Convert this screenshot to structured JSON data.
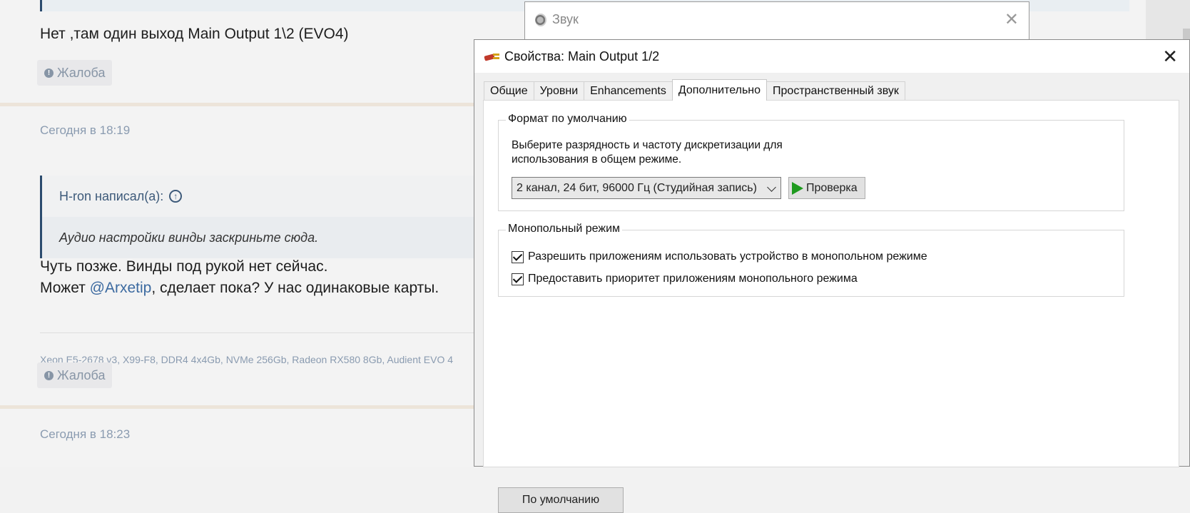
{
  "forum": {
    "post1_text": "Нет ,там один выход Main Output 1\\2 (EVO4)",
    "complain_label": "Жалоба",
    "post2_date": "Сегодня в 18:19",
    "quote_author": "H-ron написал(а):",
    "quote_text": "Аудио настройки винды заскриньте сюда.",
    "post2_line1": "Чуть позже. Винды под рукой нет сейчас.",
    "post2_line2_pre": "Может ",
    "post2_mention": "@Arxetip",
    "post2_line2_post": ", сделает пока? У нас одинаковые карты.",
    "signature": "Xeon E5-2678 v3, X99-F8, DDR4 4x4Gb, NVMe 256Gb, Radeon RX580 8Gb, Audient EVO 4",
    "post3_date": "Сегодня в 18:23"
  },
  "sound_dialog": {
    "title": "Звук"
  },
  "props_dialog": {
    "title": "Свойства: Main Output 1/2",
    "tabs": [
      {
        "label": "Общие"
      },
      {
        "label": "Уровни"
      },
      {
        "label": "Enhancements"
      },
      {
        "label": "Дополнительно"
      },
      {
        "label": "Пространственный звук"
      }
    ],
    "format_group_label": "Формат по умолчанию",
    "format_desc_line1": "Выберите разрядность и частоту дискретизации для",
    "format_desc_line2": "использования в общем режиме.",
    "format_value": "2 канал, 24 бит, 96000 Гц (Студийная запись)",
    "test_button": "Проверка",
    "exclusive_group_label": "Монопольный режим",
    "exclusive_allow": "Разрешить приложениям использовать устройство в монопольном режиме",
    "exclusive_priority": "Предоставить приоритет приложениям монопольного режима",
    "default_button": "По умолчанию"
  },
  "colors": {
    "accent_link": "#3c6aa0",
    "play_green": "#1e9a1e"
  }
}
